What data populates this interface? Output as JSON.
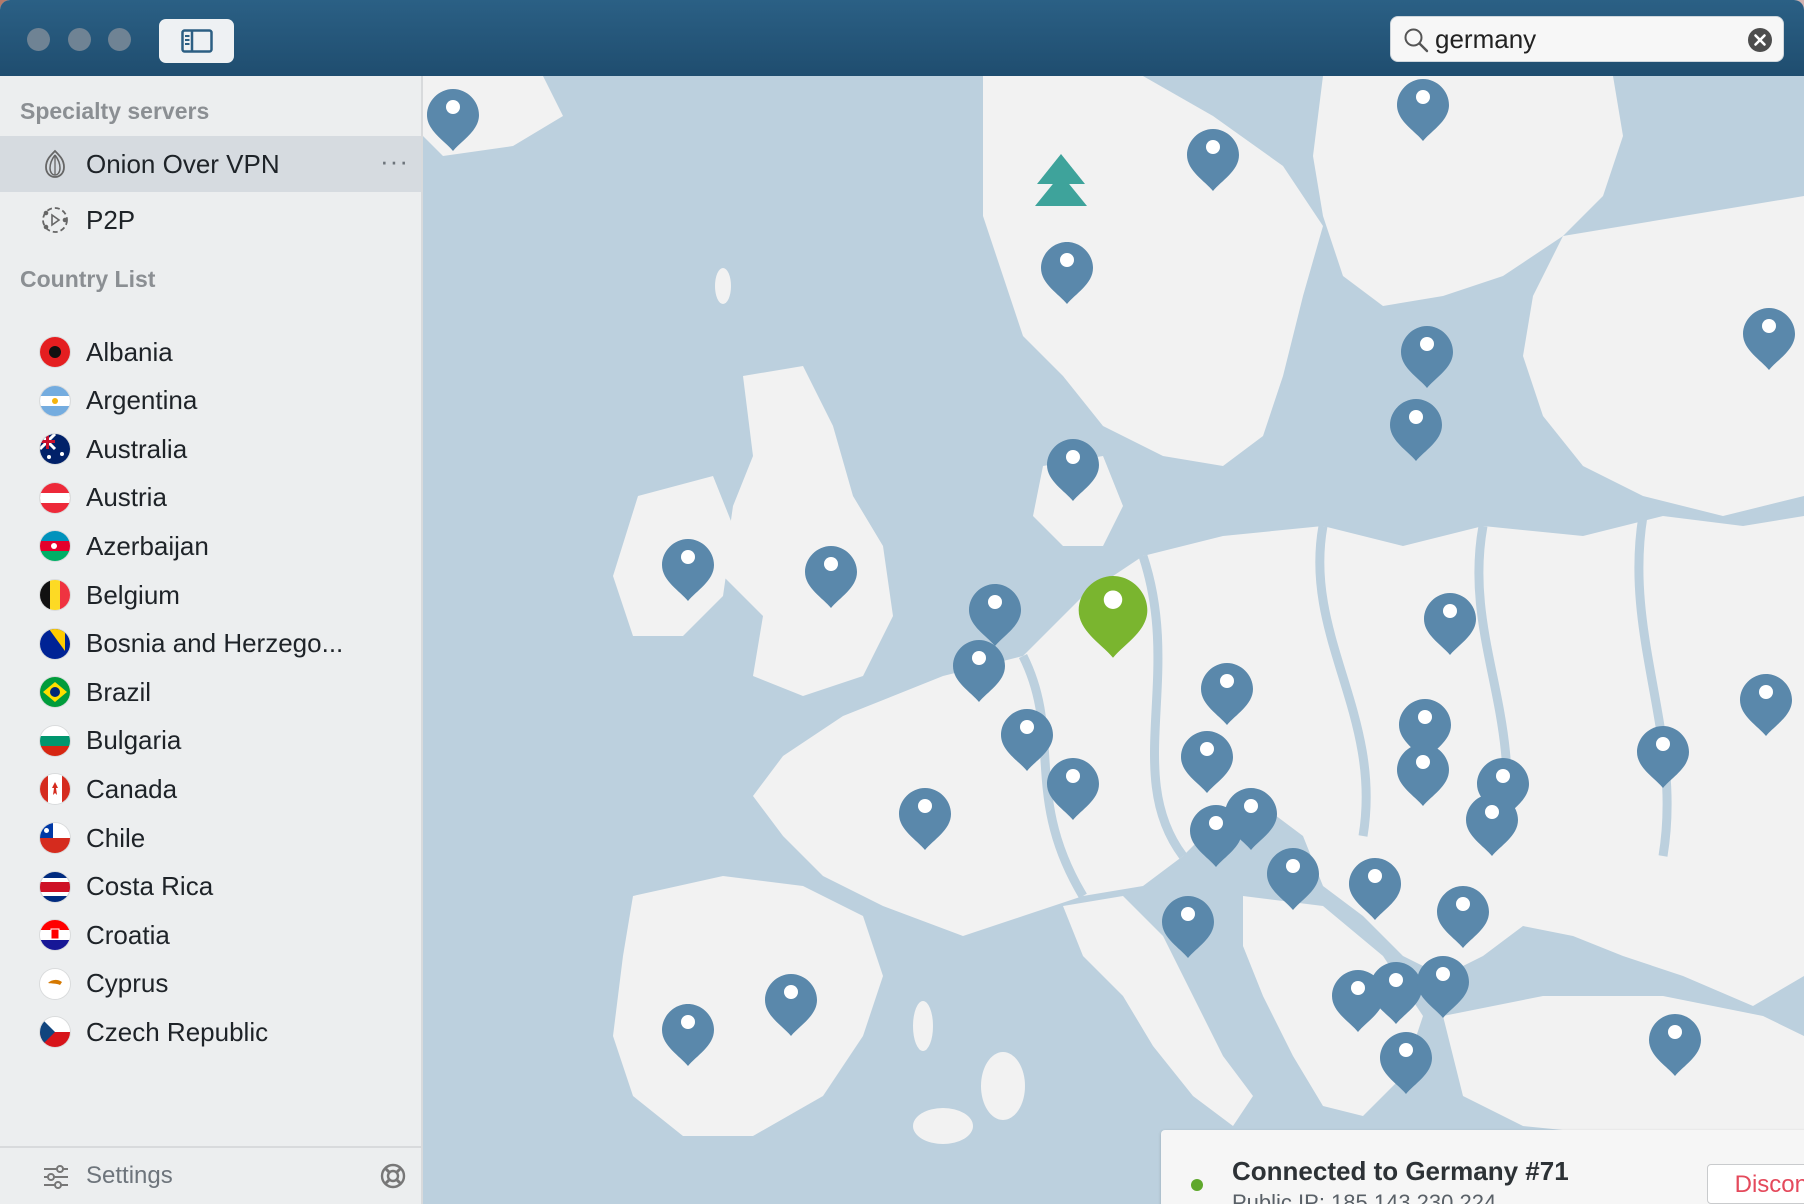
{
  "titlebar": {
    "search": {
      "value": "germany",
      "placeholder": "Search"
    }
  },
  "sidebar": {
    "specialty_header": "Specialty servers",
    "specialty": [
      {
        "label": "Onion Over VPN",
        "icon": "onion-icon",
        "selected": true,
        "more": "···"
      },
      {
        "label": "P2P",
        "icon": "p2p-icon",
        "selected": false
      }
    ],
    "country_header": "Country List",
    "countries": [
      {
        "label": "Albania",
        "flag": "albania"
      },
      {
        "label": "Argentina",
        "flag": "argentina"
      },
      {
        "label": "Australia",
        "flag": "australia"
      },
      {
        "label": "Austria",
        "flag": "austria"
      },
      {
        "label": "Azerbaijan",
        "flag": "azerbaijan"
      },
      {
        "label": "Belgium",
        "flag": "belgium"
      },
      {
        "label": "Bosnia and Herzego...",
        "flag": "bosnia"
      },
      {
        "label": "Brazil",
        "flag": "brazil"
      },
      {
        "label": "Bulgaria",
        "flag": "bulgaria"
      },
      {
        "label": "Canada",
        "flag": "canada"
      },
      {
        "label": "Chile",
        "flag": "chile"
      },
      {
        "label": "Costa Rica",
        "flag": "costa-rica"
      },
      {
        "label": "Croatia",
        "flag": "croatia"
      },
      {
        "label": "Cyprus",
        "flag": "cyprus"
      },
      {
        "label": "Czech Republic",
        "flag": "czech"
      }
    ],
    "settings_label": "Settings"
  },
  "status": {
    "title": "Connected to Germany #71",
    "ip": "Public IP: 185.143.230.224",
    "disconnect_label": "Disconnect",
    "connected_color": "#5fa82c"
  },
  "zoom": {
    "out_label": "−",
    "in_label": "+"
  },
  "colors": {
    "pin": "#5a88ab",
    "active_pin": "#7ab52f",
    "land": "#f2f2f2",
    "water": "#bcd0de"
  }
}
